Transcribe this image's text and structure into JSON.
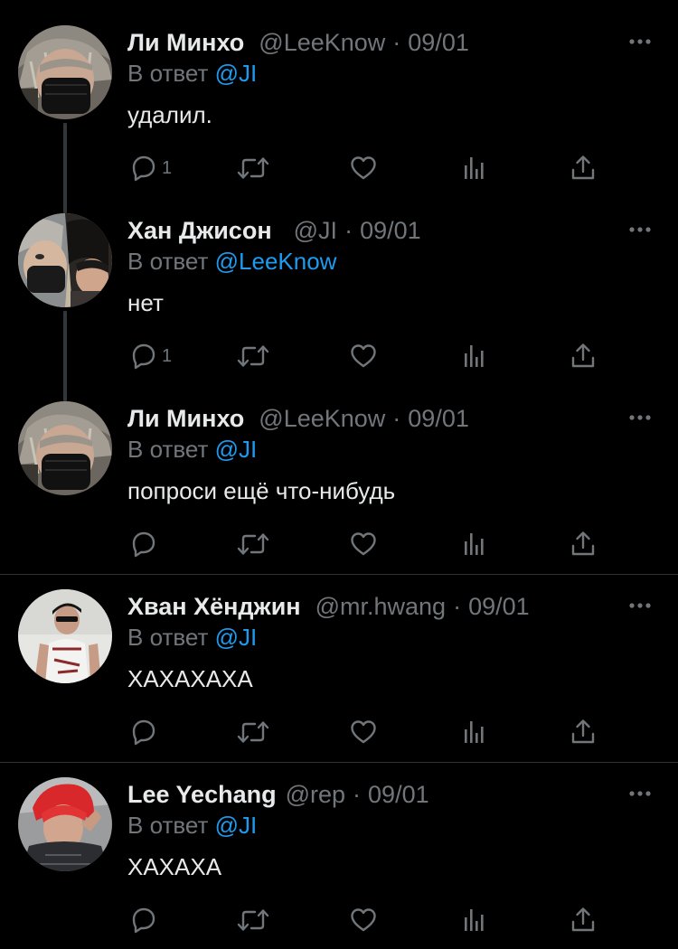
{
  "colors": {
    "background": "#000000",
    "text": "#e7e9ea",
    "secondary": "#71767b",
    "link": "#1d9bf0",
    "divider": "#2f3336"
  },
  "labels": {
    "reply_prefix": "В ответ",
    "separator": "·"
  },
  "icons": {
    "more": "more-horizontal-icon",
    "reply": "reply-icon",
    "retweet": "retweet-icon",
    "like": "heart-icon",
    "views": "views-chart-icon",
    "share": "share-icon"
  },
  "tweets": [
    {
      "name": "Ли Минхо",
      "handle": "@LeeKnow",
      "date": "09/01",
      "reply_to": "@JI",
      "text": "удалил.",
      "reply_count": "1"
    },
    {
      "name": "Хан Джисон",
      "handle": "@JI",
      "date": "09/01",
      "reply_to": "@LeeKnow",
      "text": "нет",
      "reply_count": "1"
    },
    {
      "name": "Ли Минхо",
      "handle": "@LeeKnow",
      "date": "09/01",
      "reply_to": "@JI",
      "text": "попроси ещё что-нибудь",
      "reply_count": ""
    },
    {
      "name": "Хван Хёнджин",
      "handle": "@mr.hwang",
      "date": "09/01",
      "reply_to": "@JI",
      "text": "ХАХАХАХА",
      "reply_count": ""
    },
    {
      "name": "Lee Yechang",
      "handle": "@rep",
      "date": "09/01",
      "reply_to": "@JI",
      "text": "ХАХАХА",
      "reply_count": ""
    }
  ]
}
